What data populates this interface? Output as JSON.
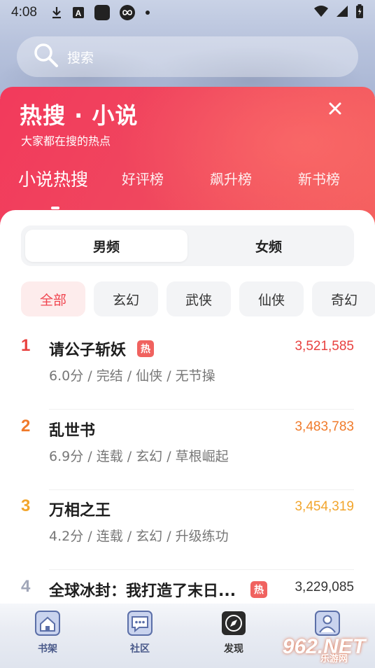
{
  "status_bar": {
    "time": "4:08",
    "icons": [
      "download-icon",
      "notification-a-icon",
      "app-square-icon",
      "infinity-icon",
      "dot-icon",
      "wifi-icon",
      "signal-icon",
      "battery-icon"
    ]
  },
  "search": {
    "placeholder": "搜索"
  },
  "header": {
    "title": "热搜 · 小说",
    "subtitle": "大家都在搜的热点",
    "close_icon": "close-icon"
  },
  "tabs": [
    {
      "label": "小说热搜",
      "active": true
    },
    {
      "label": "好评榜",
      "active": false
    },
    {
      "label": "飙升榜",
      "active": false
    },
    {
      "label": "新书榜",
      "active": false
    }
  ],
  "gender_tabs": [
    {
      "label": "男频",
      "active": true
    },
    {
      "label": "女频",
      "active": false
    }
  ],
  "categories": [
    {
      "label": "全部",
      "active": true
    },
    {
      "label": "玄幻",
      "active": false
    },
    {
      "label": "武侠",
      "active": false
    },
    {
      "label": "仙侠",
      "active": false
    },
    {
      "label": "奇幻",
      "active": false
    }
  ],
  "rank_list": [
    {
      "rank": "1",
      "title": "请公子斩妖",
      "hot": true,
      "hot_label": "热",
      "meta": "6.0分 / 完结 / 仙侠 / 无节操",
      "count": "3,521,585",
      "color": "#e8413f"
    },
    {
      "rank": "2",
      "title": "乱世书",
      "hot": false,
      "hot_label": "",
      "meta": "6.9分 / 连载 / 玄幻 / 草根崛起",
      "count": "3,483,783",
      "color": "#f07a2a"
    },
    {
      "rank": "3",
      "title": "万相之王",
      "hot": false,
      "hot_label": "",
      "meta": "4.2分 / 连载 / 玄幻 / 升级练功",
      "count": "3,454,319",
      "color": "#f2a52c"
    },
    {
      "rank": "4",
      "title": "全球冰封：我打造了末日...",
      "hot": true,
      "hot_label": "热",
      "meta": "",
      "count": "3,229,085",
      "color": "#a0a6b8"
    }
  ],
  "bottom_nav": [
    {
      "label": "书架",
      "icon": "home-icon",
      "active": false
    },
    {
      "label": "社区",
      "icon": "chat-icon",
      "active": false
    },
    {
      "label": "发现",
      "icon": "compass-icon",
      "active": true
    },
    {
      "label": "",
      "icon": "profile-icon",
      "active": false
    }
  ],
  "watermark": {
    "text": "962.NET",
    "sub": "乐游网"
  }
}
